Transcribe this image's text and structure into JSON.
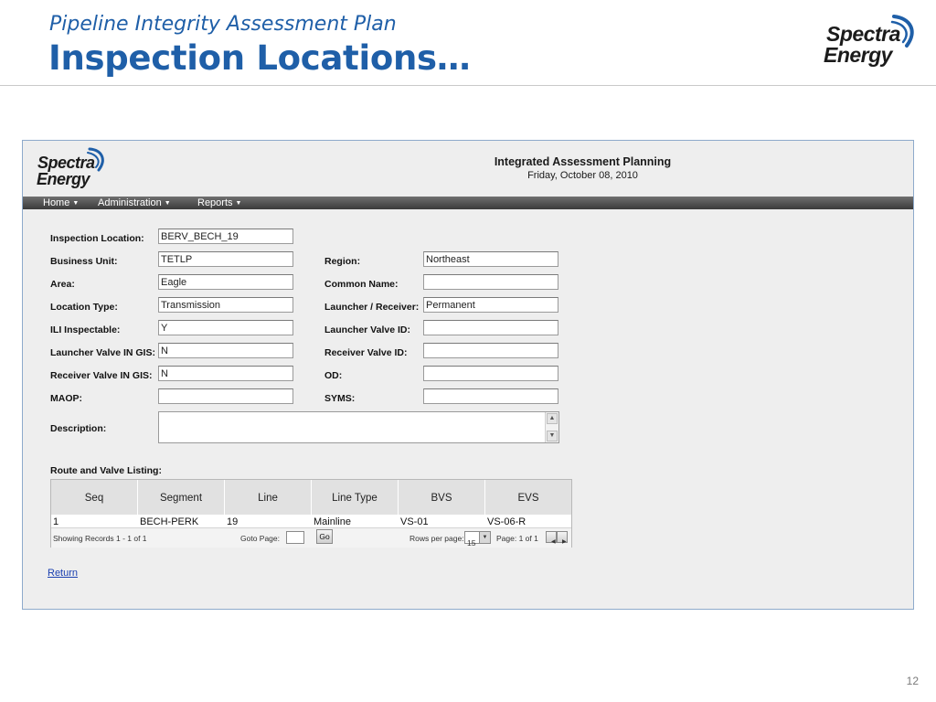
{
  "slide": {
    "subtitle": "Pipeline Integrity Assessment Plan",
    "title": "Inspection Locations…",
    "logo_line1": "Spectra",
    "logo_line2": "Energy",
    "page_number": "12"
  },
  "app": {
    "logo_line1": "Spectra",
    "logo_line2": "Energy",
    "title": "Integrated Assessment Planning",
    "date": "Friday, October 08, 2010",
    "menu": [
      "Home",
      "Administration",
      "Reports"
    ]
  },
  "form": {
    "labels": {
      "inspection_location": "Inspection Location:",
      "business_unit": "Business Unit:",
      "area": "Area:",
      "location_type": "Location Type:",
      "ili_inspectable": "ILI Inspectable:",
      "launcher_valve_in_gis": "Launcher Valve IN GIS:",
      "receiver_valve_in_gis": "Receiver Valve IN GIS:",
      "maop": "MAOP:",
      "description": "Description:",
      "region": "Region:",
      "common_name": "Common Name:",
      "launcher_receiver": "Launcher / Receiver:",
      "launcher_valve_id": "Launcher Valve ID:",
      "receiver_valve_id": "Receiver Valve ID:",
      "od": "OD:",
      "syms": "SYMS:"
    },
    "values": {
      "inspection_location": "BERV_BECH_19",
      "business_unit": "TETLP",
      "area": "Eagle",
      "location_type": "Transmission",
      "ili_inspectable": "Y",
      "launcher_valve_in_gis": "N",
      "receiver_valve_in_gis": "N",
      "maop": "",
      "description": "",
      "region": "Northeast",
      "common_name": "",
      "launcher_receiver": "Permanent",
      "launcher_valve_id": "",
      "receiver_valve_id": "",
      "od": "",
      "syms": ""
    }
  },
  "route": {
    "heading": "Route and Valve Listing:",
    "columns": [
      "Seq",
      "Segment",
      "Line",
      "Line Type",
      "BVS",
      "EVS"
    ],
    "rows": [
      [
        "1",
        "BECH-PERK",
        "19",
        "Mainline",
        "VS-01",
        "VS-06-R"
      ]
    ],
    "footer": {
      "showing": "Showing Records 1 - 1 of 1",
      "goto_label": "Goto Page:",
      "go_label": "Go",
      "rows_per_page_label": "Rows per page:",
      "rows_per_page_value": "15",
      "page_info": "Page: 1 of 1"
    }
  },
  "return_label": "Return",
  "colors": {
    "title_blue": "#1f5fa8",
    "logo_swoosh": "#1f5fa8",
    "link_blue": "#1a3fb0",
    "nav_bar": "#4a4a4a"
  }
}
